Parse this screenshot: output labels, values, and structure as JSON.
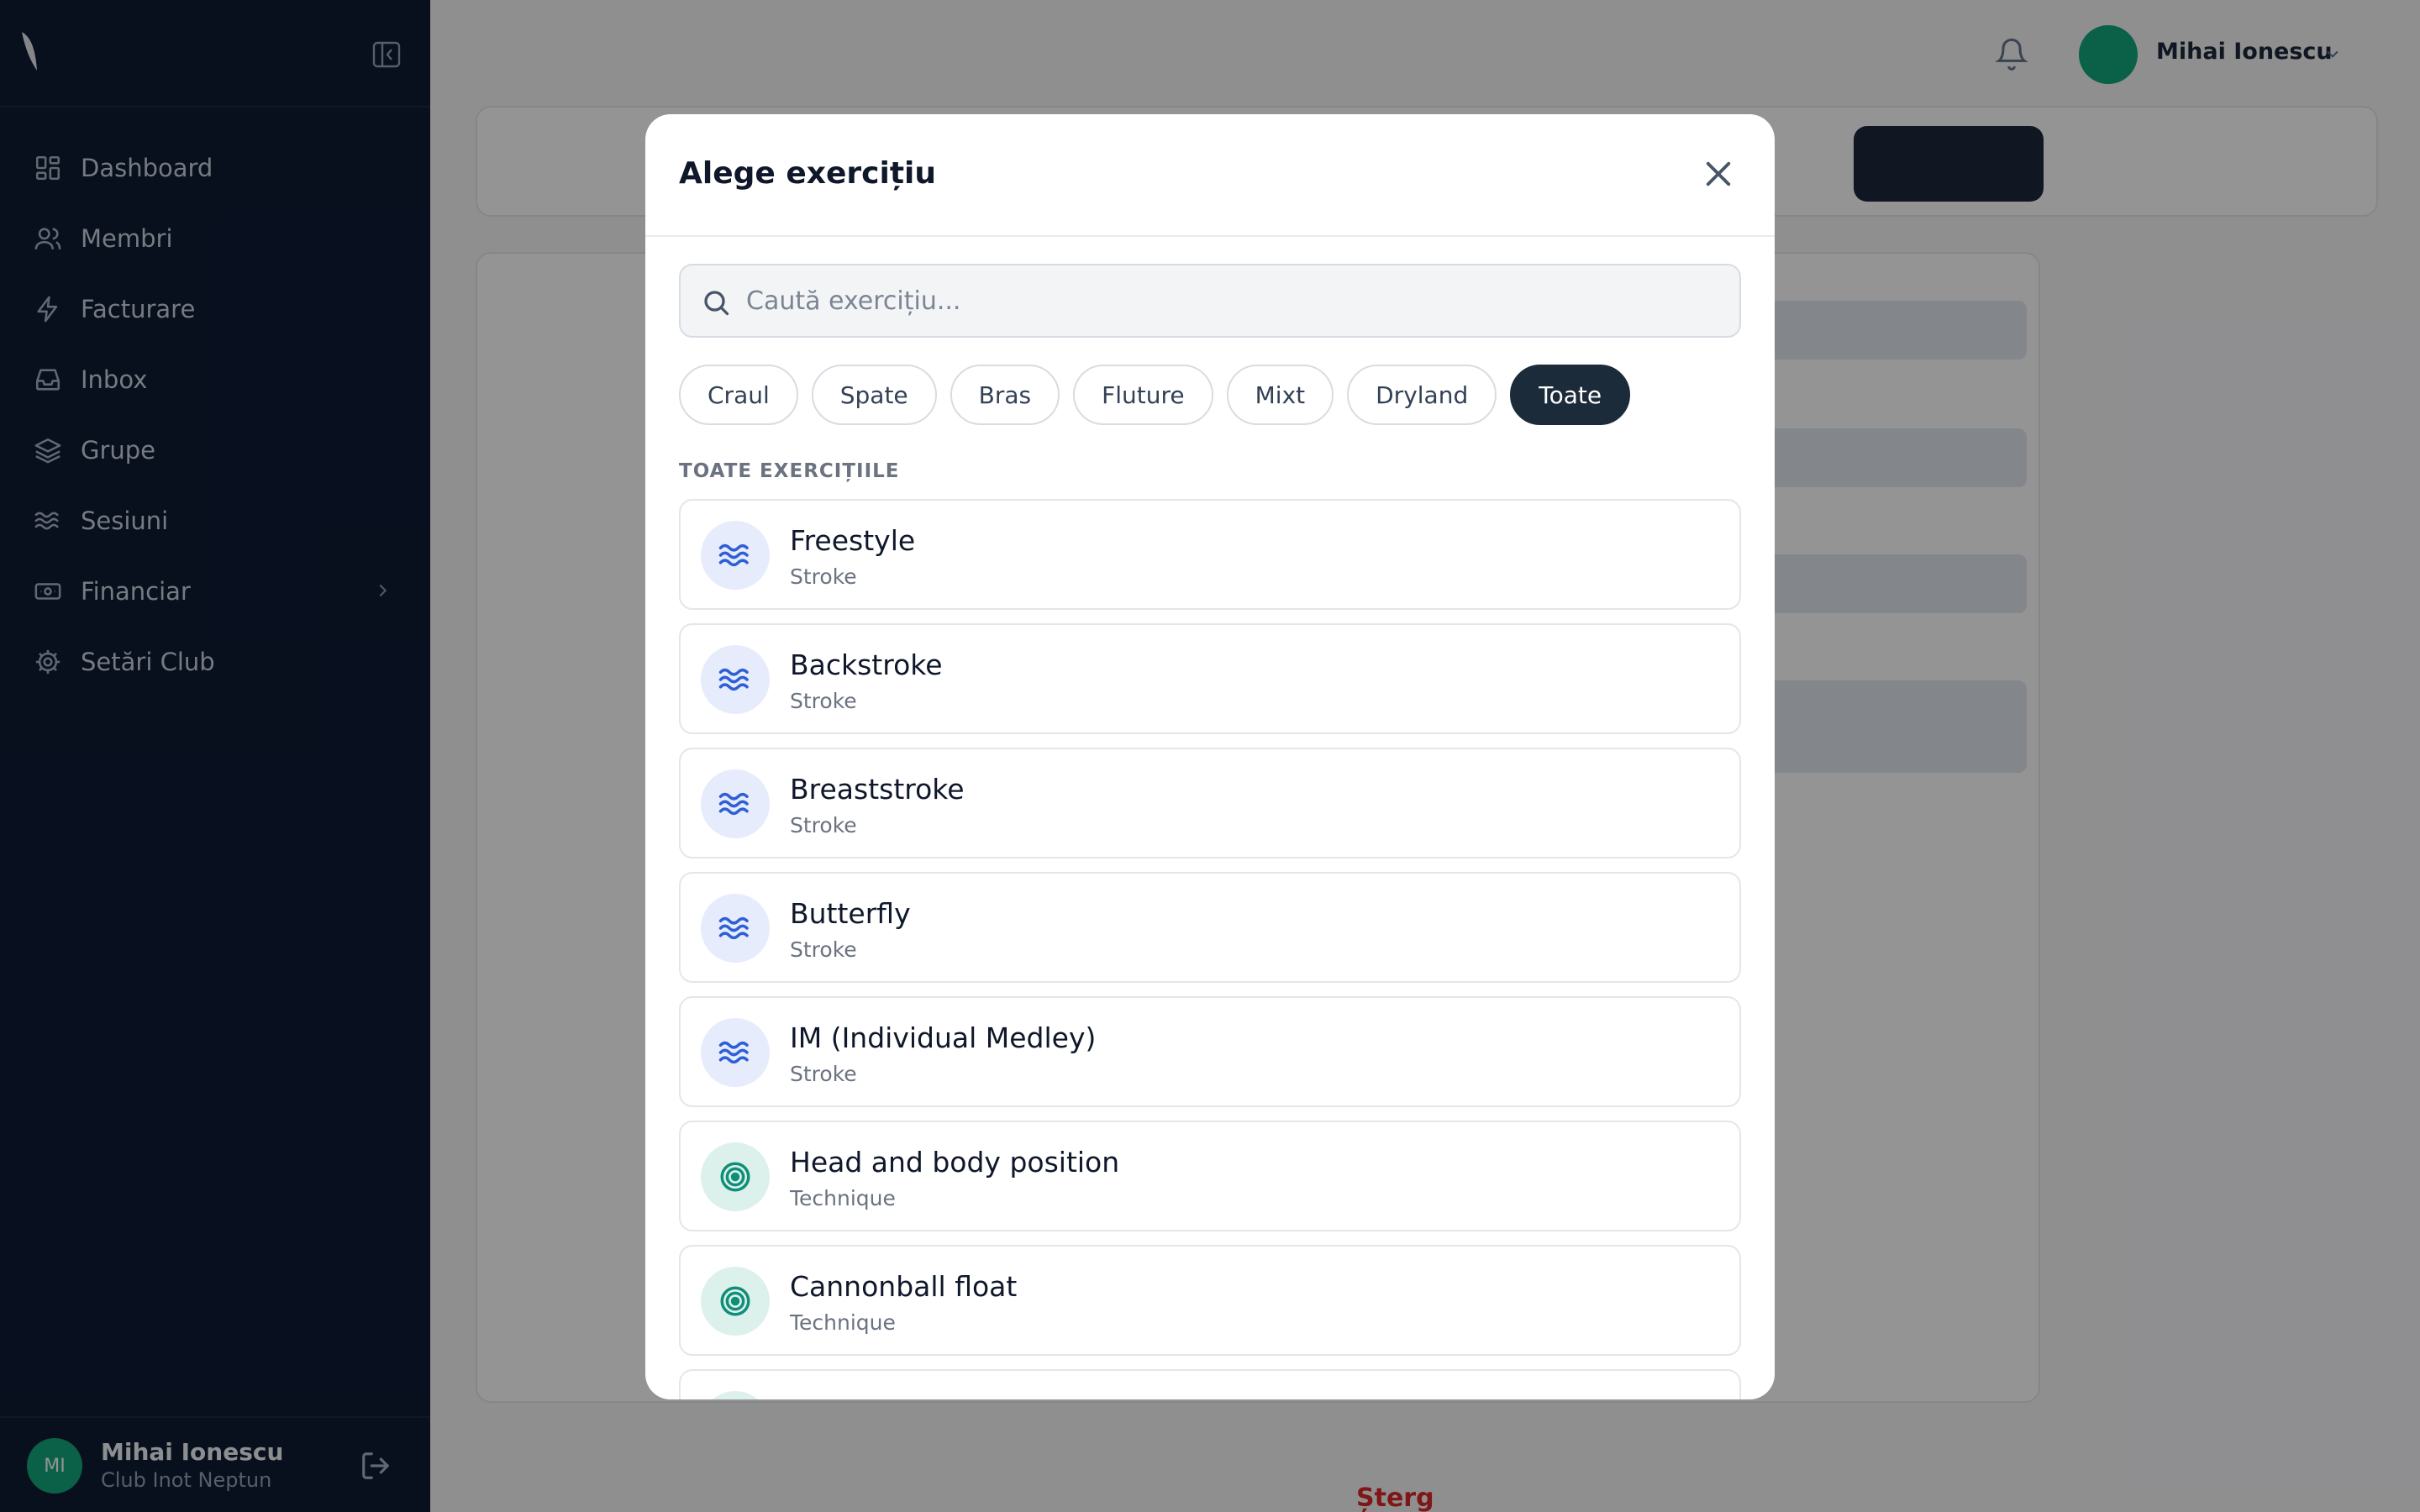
{
  "sidebar": {
    "nav": [
      {
        "label": "Dashboard",
        "icon": "dashboard-icon"
      },
      {
        "label": "Membri",
        "icon": "users-icon"
      },
      {
        "label": "Facturare",
        "icon": "bolt-icon"
      },
      {
        "label": "Inbox",
        "icon": "inbox-icon"
      },
      {
        "label": "Grupe",
        "icon": "layers-icon"
      },
      {
        "label": "Sesiuni",
        "icon": "waves-icon"
      },
      {
        "label": "Financiar",
        "icon": "cash-icon",
        "has_submenu": true
      },
      {
        "label": "Setări Club",
        "icon": "gear-icon"
      }
    ],
    "user": {
      "initials": "MI",
      "name": "Mihai Ionescu",
      "club": "Club Inot Neptun"
    }
  },
  "header": {
    "user_name": "Mihai Ionescu"
  },
  "background": {
    "delete_label": "Șterg"
  },
  "modal": {
    "title": "Alege exercițiu",
    "search_placeholder": "Caută exercițiu...",
    "filters": [
      "Craul",
      "Spate",
      "Bras",
      "Fluture",
      "Mixt",
      "Dryland",
      "Toate"
    ],
    "active_filter": "Toate",
    "section_label": "TOATE EXERCIȚIILE",
    "exercises": [
      {
        "name": "Freestyle",
        "category": "Stroke",
        "icon": "waves-icon"
      },
      {
        "name": "Backstroke",
        "category": "Stroke",
        "icon": "waves-icon"
      },
      {
        "name": "Breaststroke",
        "category": "Stroke",
        "icon": "waves-icon"
      },
      {
        "name": "Butterfly",
        "category": "Stroke",
        "icon": "waves-icon"
      },
      {
        "name": "IM (Individual Medley)",
        "category": "Stroke",
        "icon": "waves-icon"
      },
      {
        "name": "Head and body position",
        "category": "Technique",
        "icon": "target-icon"
      },
      {
        "name": "Cannonball float",
        "category": "Technique",
        "icon": "target-icon"
      }
    ]
  },
  "colors": {
    "sidebar_bg": "#0e1a33",
    "accent_green": "#12a87a",
    "chip_active": "#1c2b3a",
    "stroke_icon": "#2f5fd6",
    "technique_icon": "#0f8f78"
  }
}
